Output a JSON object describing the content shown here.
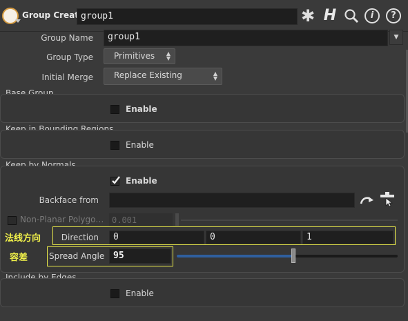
{
  "header": {
    "node_type": "Group Create",
    "node_name": "group1"
  },
  "params": {
    "group_name_label": "Group Name",
    "group_name_value": "group1",
    "group_type_label": "Group Type",
    "group_type_value": "Primitives",
    "initial_merge_label": "Initial Merge",
    "initial_merge_value": "Replace Existing"
  },
  "base_group": {
    "title": "Base Group",
    "enable_label": "Enable",
    "enabled": false
  },
  "bounding": {
    "title": "Keep in Bounding Regions",
    "enable_label": "Enable",
    "enabled": false
  },
  "normals": {
    "title": "Keep by Normals",
    "enable_label": "Enable",
    "enabled": true,
    "backface_label": "Backface from",
    "backface_value": "",
    "nonplanar_label": "Non-Planar Polygo…",
    "nonplanar_value": "0.001",
    "direction_label": "Direction",
    "direction": [
      "0",
      "0",
      "1"
    ],
    "direction_annotation": "法线方向",
    "spread_label": "Spread Angle",
    "spread_value": "95",
    "spread_annotation": "容差",
    "spread_fraction": 0.528
  },
  "edges": {
    "title": "Include by Edges",
    "enable_label": "Enable",
    "enabled": false
  },
  "colors": {
    "highlight": "#e8e84a",
    "slider_fill": "#2f5f9e"
  },
  "icons": [
    "node-icon",
    "gear-icon",
    "houdini-h-icon",
    "search-icon",
    "info-icon",
    "help-icon",
    "arrow-jump-icon",
    "selector-icon",
    "dropdown-icon"
  ]
}
